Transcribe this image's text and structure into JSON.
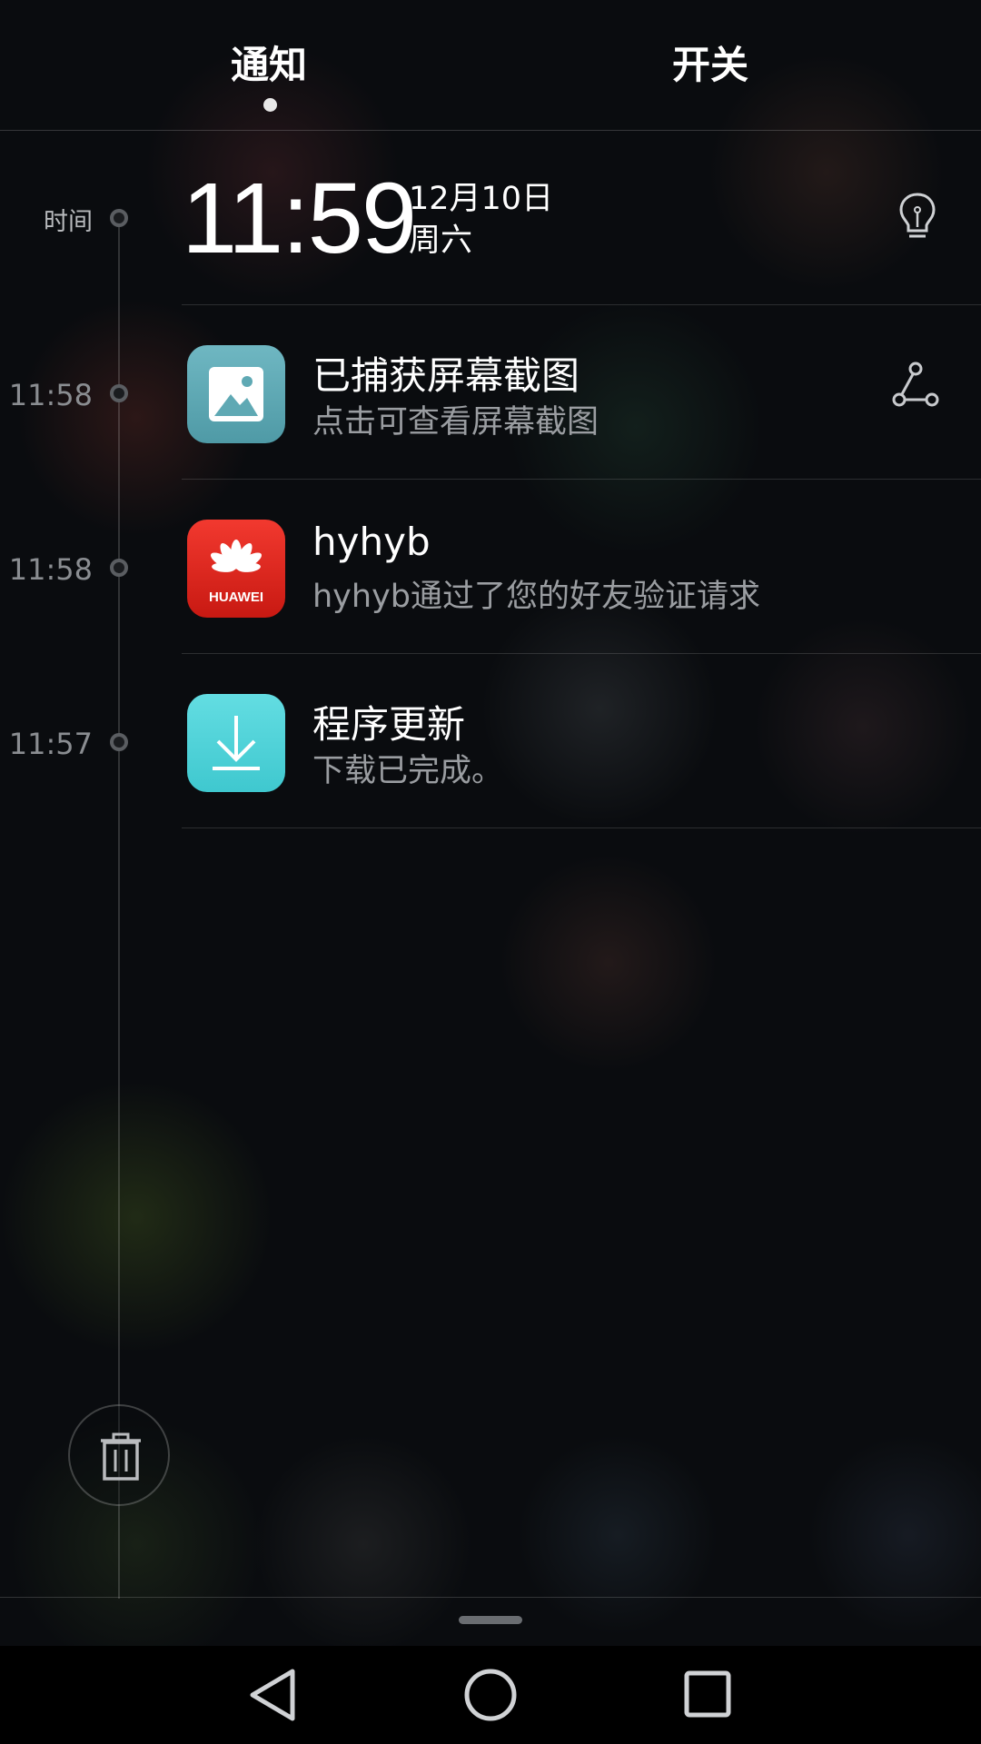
{
  "tabs": [
    {
      "label": "通知",
      "active": true
    },
    {
      "label": "开关",
      "active": false
    }
  ],
  "timeline": {
    "header_label": "时间",
    "clock": {
      "time": "11:59",
      "date": "12月10日",
      "weekday": "周六"
    },
    "notifications": [
      {
        "time": "11:58",
        "app_icon": "gallery-icon",
        "title": "已捕获屏幕截图",
        "body": "点击可查看屏幕截图",
        "action_icon": "share-icon"
      },
      {
        "time": "11:58",
        "app_icon": "huawei-icon",
        "title": "hyhyb",
        "body": "hyhyb通过了您的好友验证请求"
      },
      {
        "time": "11:57",
        "app_icon": "download-icon",
        "title": "程序更新",
        "body": "下载已完成。"
      }
    ]
  },
  "icons": {
    "bulb": "lightbulb-icon",
    "trash": "trash-icon",
    "huawei_logo_text": "HUAWEI",
    "nav": [
      "back-icon",
      "home-icon",
      "recents-icon"
    ]
  },
  "colors": {
    "background": "#0a0c0f",
    "gallery_icon": "#5fa9b4",
    "huawei_icon": "#e02a22",
    "update_icon": "#52d3d9",
    "secondary_text": "#9a9da1"
  }
}
